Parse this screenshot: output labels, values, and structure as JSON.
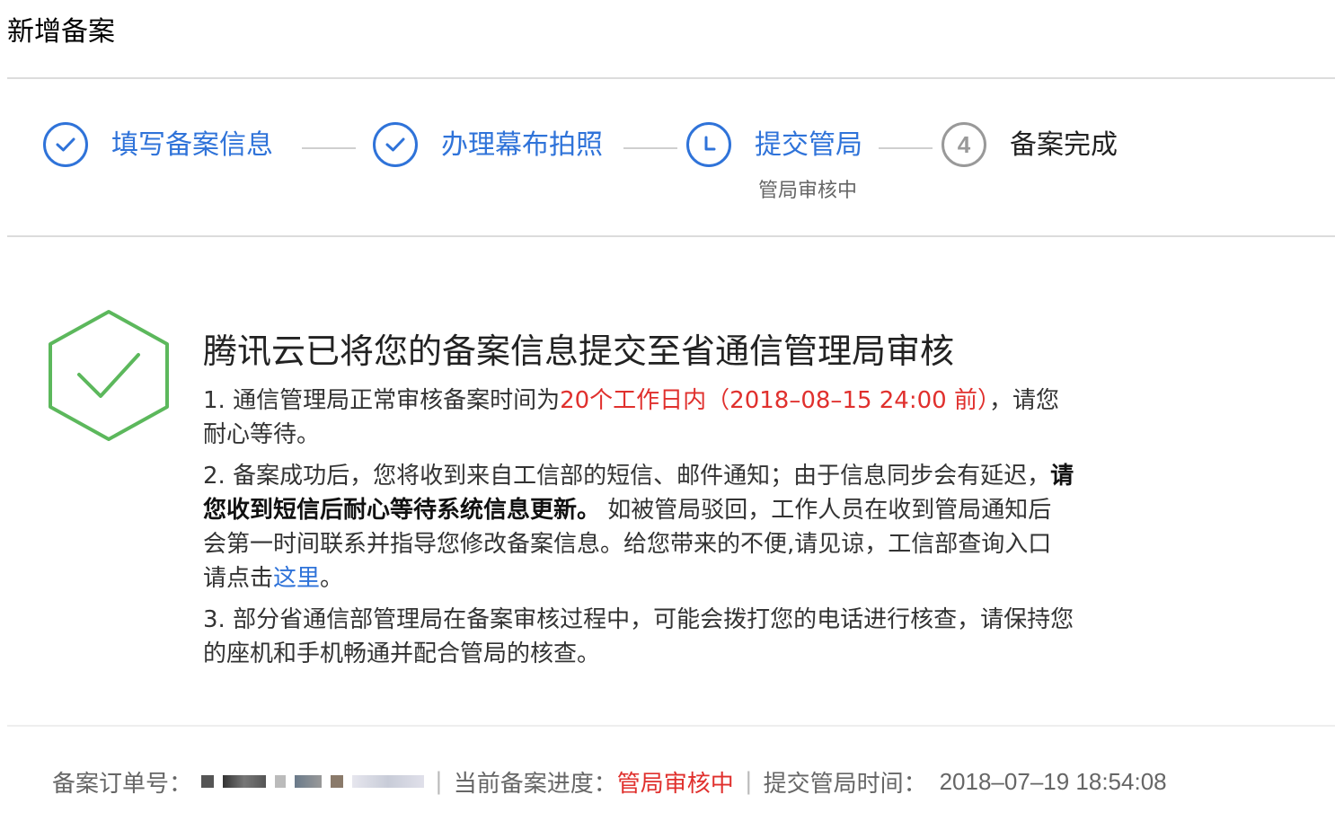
{
  "page": {
    "title": "新增备案"
  },
  "steps": [
    {
      "label": "填写备案信息",
      "status": "completed"
    },
    {
      "label": "办理幕布拍照",
      "status": "completed"
    },
    {
      "label": "提交管局",
      "status": "current",
      "sub": "管局审核中"
    },
    {
      "label": "备案完成",
      "status": "pending",
      "number": "4"
    }
  ],
  "main": {
    "heading": "腾讯云已将您的备案信息提交至省通信管理局审核",
    "note1_prefix": "1. 通信管理局正常审核备案时间为",
    "note1_highlight": "20个工作日内（2018–08–15 24:00 前）",
    "note1_suffix": "，请您耐心等待。",
    "note2_prefix": "2. 备案成功后，您将收到来自工信部的短信、邮件通知；由于信息同步会有延迟，",
    "note2_bold": "请您收到短信后耐心等待系统信息更新。",
    "note2_middle": " 如被管局驳回，工作人员在收到管局通知后会第一时间联系并指导您修改备案信息。给您带来的不便,请见谅，工信部查询入口请点击",
    "note2_link": "这里",
    "note2_end": "。",
    "note3": "3. 部分省通信部管理局在备案审核过程中，可能会拨打您的电话进行核查，请保持您的座机和手机畅通并配合管局的核查。"
  },
  "footer": {
    "order_label": "备案订单号：",
    "separator": "|",
    "progress_label": "当前备案进度：",
    "progress_value": "管局审核中",
    "submit_label": "提交管局时间：",
    "submit_time": "2018–07–19 18:54:08"
  },
  "colors": {
    "accent": "#2f73d9",
    "success": "#5cb85c",
    "danger": "#e0302d"
  }
}
